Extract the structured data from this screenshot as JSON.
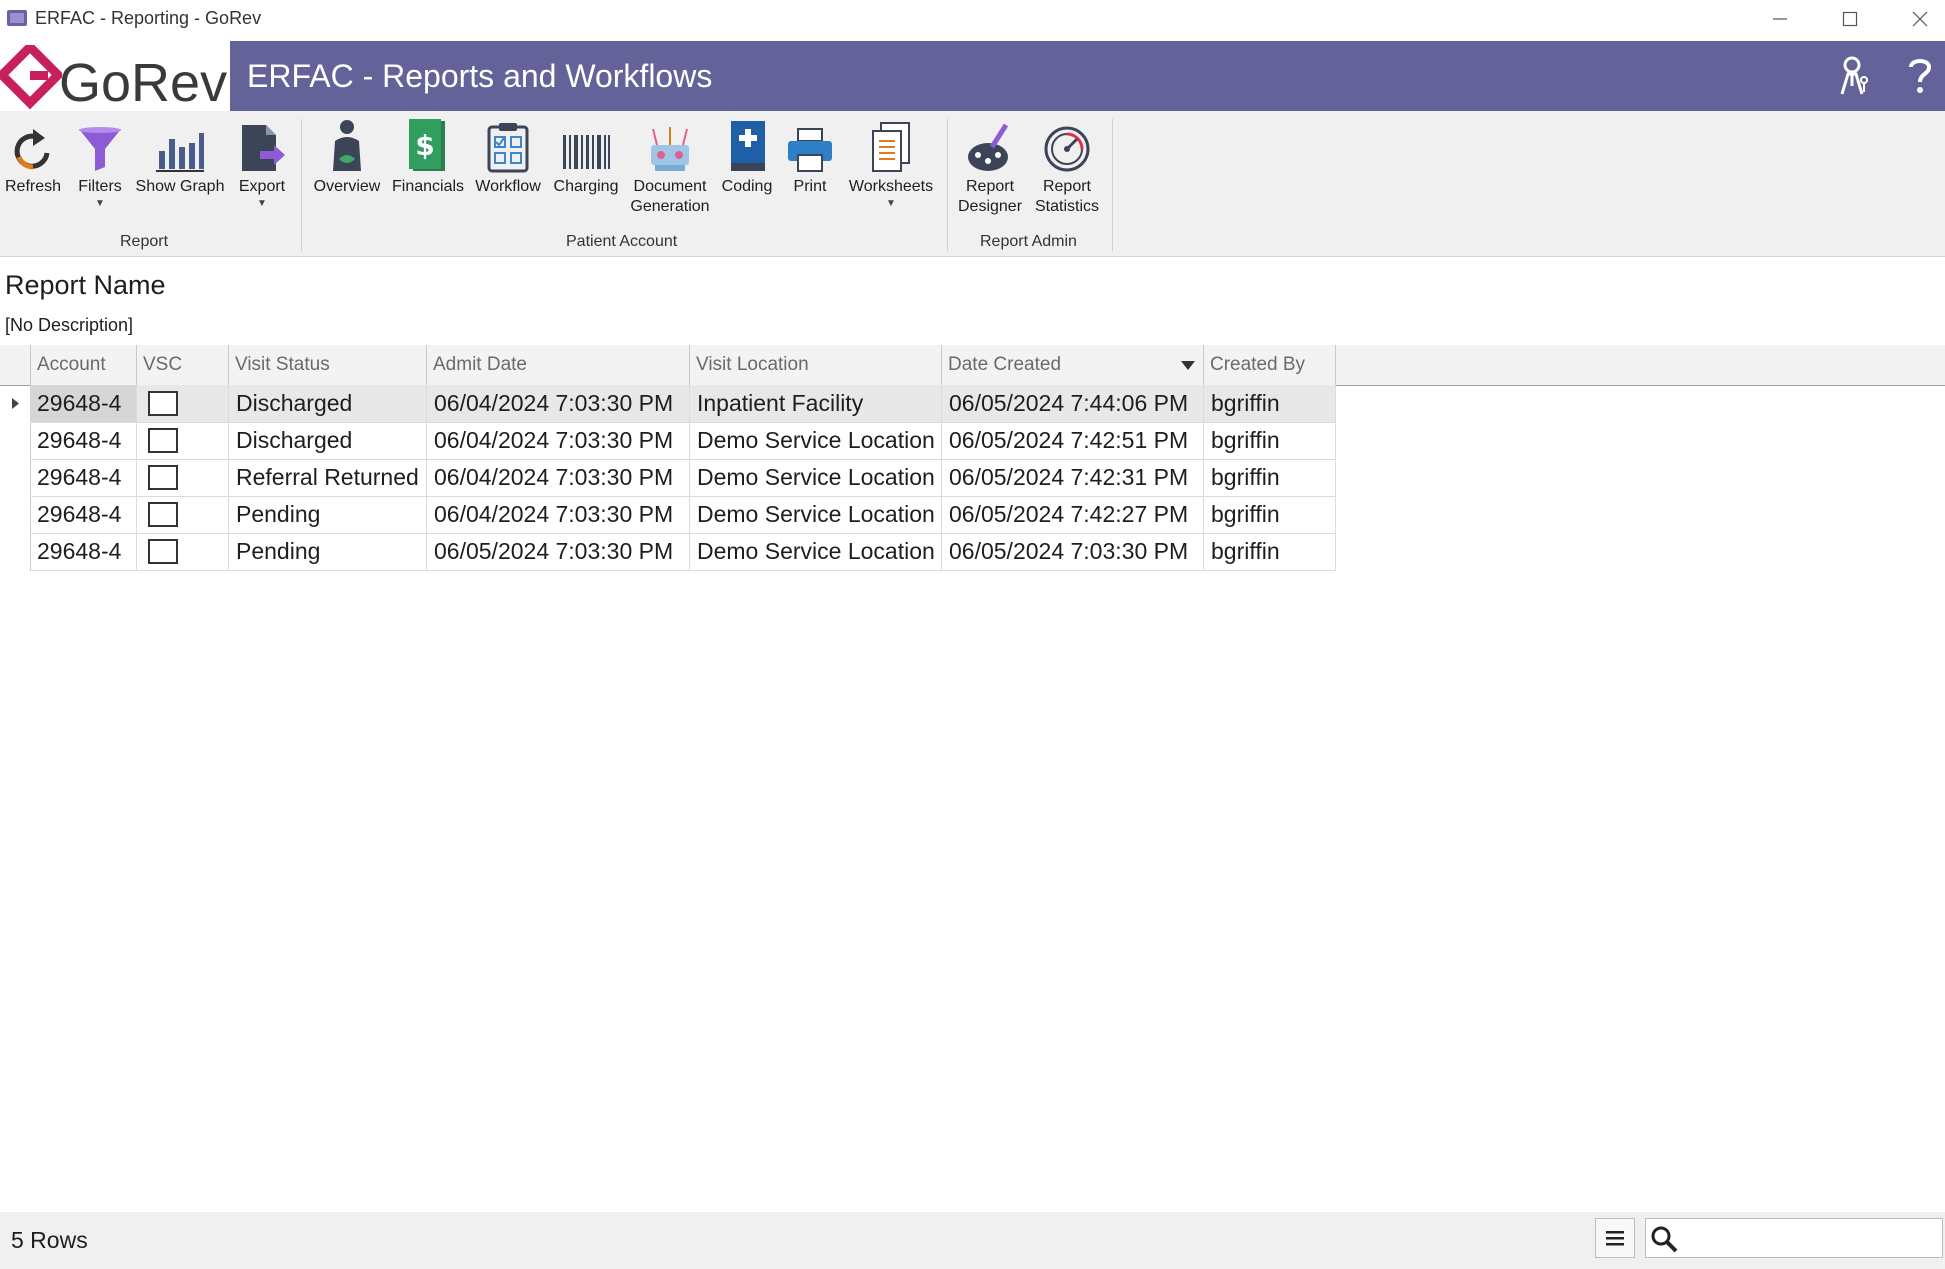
{
  "window": {
    "title": "ERFAC - Reporting - GoRev",
    "minimize_icon": "minimize-icon",
    "maximize_icon": "maximize-icon",
    "close_icon": "close-icon"
  },
  "brand": {
    "logo_text": "GoRev",
    "accent": "#c8205e",
    "header_color": "#646399"
  },
  "header": {
    "title": "ERFAC - Reports and Workflows",
    "user_icon": "user-keys-icon",
    "help_icon": "help-icon"
  },
  "ribbon": {
    "groups": [
      {
        "label": "Report"
      },
      {
        "label": "Patient Account"
      },
      {
        "label": "Report Admin"
      }
    ],
    "buttons": {
      "refresh": "Refresh",
      "filters": "Filters",
      "show_graph": "Show Graph",
      "export": "Export",
      "overview": "Overview",
      "financials": "Financials",
      "workflow": "Workflow",
      "charging": "Charging",
      "document_generation_1": "Document",
      "document_generation_2": "Generation",
      "coding": "Coding",
      "print": "Print",
      "worksheets": "Worksheets",
      "report_designer_1": "Report",
      "report_designer_2": "Designer",
      "report_statistics_1": "Report",
      "report_statistics_2": "Statistics"
    }
  },
  "report": {
    "name": "Report Name",
    "description": "[No Description]"
  },
  "grid": {
    "columns": [
      "Account",
      "VSC",
      "Visit Status",
      "Admit Date",
      "Visit Location",
      "Date Created",
      "Created By"
    ],
    "sorted_column": "Date Created",
    "sort_direction": "descending",
    "rows": [
      {
        "account": "29648-4",
        "vsc": false,
        "visit_status": "Discharged",
        "admit_date": "06/04/2024 7:03:30 PM",
        "visit_location": "Inpatient Facility",
        "date_created": "06/05/2024 7:44:06 PM",
        "created_by": "bgriffin"
      },
      {
        "account": "29648-4",
        "vsc": false,
        "visit_status": "Discharged",
        "admit_date": "06/04/2024 7:03:30 PM",
        "visit_location": "Demo Service Location",
        "date_created": "06/05/2024 7:42:51 PM",
        "created_by": "bgriffin"
      },
      {
        "account": "29648-4",
        "vsc": false,
        "visit_status": "Referral Returned",
        "admit_date": "06/04/2024 7:03:30 PM",
        "visit_location": "Demo Service Location",
        "date_created": "06/05/2024 7:42:31 PM",
        "created_by": "bgriffin"
      },
      {
        "account": "29648-4",
        "vsc": false,
        "visit_status": "Pending",
        "admit_date": "06/04/2024 7:03:30 PM",
        "visit_location": "Demo Service Location",
        "date_created": "06/05/2024 7:42:27 PM",
        "created_by": "bgriffin"
      },
      {
        "account": "29648-4",
        "vsc": false,
        "visit_status": "Pending",
        "admit_date": "06/05/2024 7:03:30 PM",
        "visit_location": "Demo Service Location",
        "date_created": "06/05/2024 7:03:30 PM",
        "created_by": "bgriffin"
      }
    ]
  },
  "status": {
    "rows_count": "5 Rows",
    "search_placeholder": "",
    "search_value": ""
  }
}
